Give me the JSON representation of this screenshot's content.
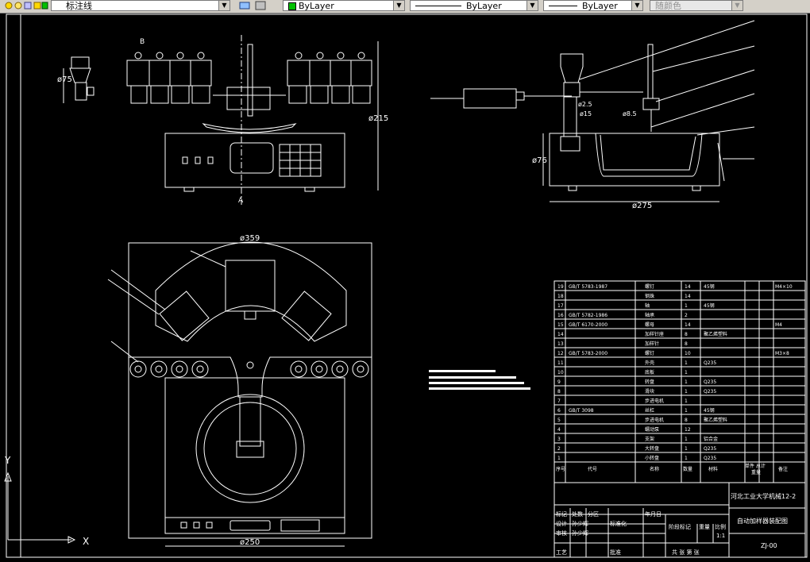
{
  "toolbar": {
    "dimstyle_label": "标注线",
    "color_label": "ByLayer",
    "linetype_label": "ByLayer",
    "lineweight_label": "ByLayer",
    "plotstyle_label": "随颜色"
  },
  "drawing": {
    "dim_phi75": "ø75",
    "dim_phi215": "ø215",
    "dim_phi359": "ø359",
    "dim_phi250": "ø250",
    "dim_phi76": "ø76",
    "dim_phi275": "ø275",
    "section_a": "A",
    "section_b": "B",
    "dim_phi2_5": "ø2.5",
    "dim_phi15": "ø15",
    "dim_phi8_5": "ø8.5",
    "ucs_y": "Y",
    "ucs_x": "X"
  },
  "bom": {
    "rows": [
      {
        "no": "19",
        "code": "GB/T 5783-1987",
        "name": "螺钉",
        "qty": "14",
        "material": "45钢",
        "note": "M4×10"
      },
      {
        "no": "18",
        "code": "",
        "name": "钢珠",
        "qty": "14",
        "material": "",
        "note": ""
      },
      {
        "no": "17",
        "code": "",
        "name": "轴",
        "qty": "1",
        "material": "45钢",
        "note": ""
      },
      {
        "no": "16",
        "code": "GB/T 5782-1986",
        "name": "轴承",
        "qty": "2",
        "material": "",
        "note": ""
      },
      {
        "no": "15",
        "code": "GB/T 6170-2000",
        "name": "螺母",
        "qty": "14",
        "material": "",
        "note": "M4"
      },
      {
        "no": "14",
        "code": "",
        "name": "加样针座",
        "qty": "8",
        "material": "聚乙烯塑料",
        "note": ""
      },
      {
        "no": "13",
        "code": "",
        "name": "加样针",
        "qty": "8",
        "material": "",
        "note": ""
      },
      {
        "no": "12",
        "code": "GB/T 5783-2000",
        "name": "螺钉",
        "qty": "10",
        "material": "",
        "note": "M3×8"
      },
      {
        "no": "11",
        "code": "",
        "name": "外壳",
        "qty": "1",
        "material": "Q235",
        "note": ""
      },
      {
        "no": "10",
        "code": "",
        "name": "底板",
        "qty": "1",
        "material": "",
        "note": ""
      },
      {
        "no": "9",
        "code": "",
        "name": "转盘",
        "qty": "1",
        "material": "Q235",
        "note": ""
      },
      {
        "no": "8",
        "code": "",
        "name": "滑块",
        "qty": "1",
        "material": "Q235",
        "note": ""
      },
      {
        "no": "7",
        "code": "",
        "name": "步进电机",
        "qty": "1",
        "material": "",
        "note": ""
      },
      {
        "no": "6",
        "code": "GB/T 3098",
        "name": "丝杠",
        "qty": "1",
        "material": "45钢",
        "note": ""
      },
      {
        "no": "5",
        "code": "",
        "name": "步进电机",
        "qty": "8",
        "material": "聚乙烯塑料",
        "note": ""
      },
      {
        "no": "4",
        "code": "",
        "name": "蠕动泵",
        "qty": "12",
        "material": "",
        "note": ""
      },
      {
        "no": "3",
        "code": "",
        "name": "支架",
        "qty": "1",
        "material": "铝合金",
        "note": ""
      },
      {
        "no": "2",
        "code": "",
        "name": "大转盘",
        "qty": "1",
        "material": "Q235",
        "note": ""
      },
      {
        "no": "1",
        "code": "",
        "name": "小转盘",
        "qty": "1",
        "material": "Q235",
        "note": ""
      }
    ],
    "header": {
      "no": "序号",
      "code": "代号",
      "name": "名称",
      "qty": "数量",
      "material": "材料",
      "weight": "单件 总计",
      "weight2": "重量",
      "note": "备注"
    }
  },
  "title_block": {
    "school": "河北工业大学机械12-2",
    "drawing_name": "自动加样器装配图",
    "drawing_no": "ZJ-00",
    "scale_label": "比例",
    "scale": "1:1",
    "weight_label": "重量",
    "stage_label": "阶段标记",
    "sheet_label": "共 张 第 张",
    "mark_label": "标记",
    "count_label": "处数",
    "zone_label": "分区",
    "change_label": "更改文件号",
    "sign_label": "签名",
    "date_label": "年月日",
    "design_label": "设计",
    "designer": "孙少辉",
    "std_label": "标准化",
    "review_label": "审核",
    "reviewer": "孙少辉",
    "process_label": "工艺",
    "approve_label": "批准"
  }
}
